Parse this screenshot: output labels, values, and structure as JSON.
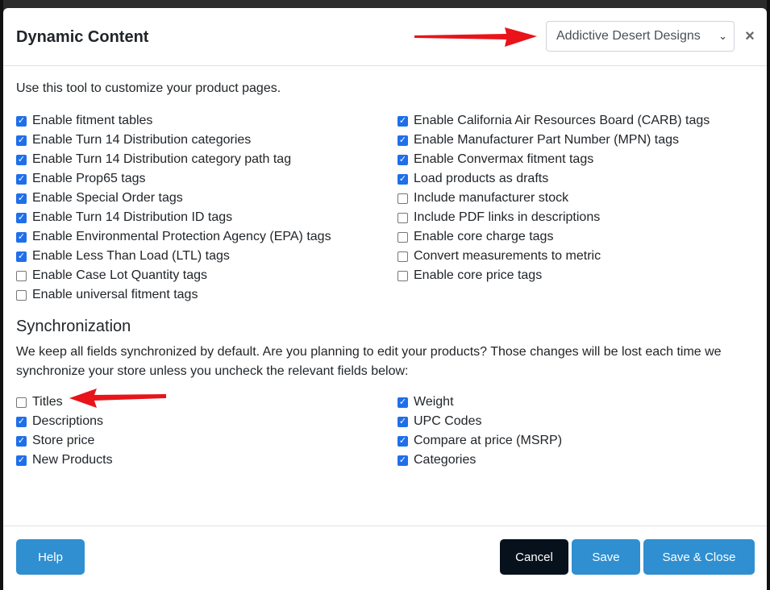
{
  "modal": {
    "title": "Dynamic Content",
    "vendor_select": {
      "value": "Addictive Desert Designs"
    },
    "close_label": "×"
  },
  "body": {
    "intro": "Use this tool to customize your product pages.",
    "options_left": [
      {
        "label": "Enable fitment tables",
        "checked": true
      },
      {
        "label": "Enable Turn 14 Distribution categories",
        "checked": true
      },
      {
        "label": "Enable Turn 14 Distribution category path tag",
        "checked": true
      },
      {
        "label": "Enable Prop65 tags",
        "checked": true
      },
      {
        "label": "Enable Special Order tags",
        "checked": true
      },
      {
        "label": "Enable Turn 14 Distribution ID tags",
        "checked": true
      },
      {
        "label": "Enable Environmental Protection Agency (EPA) tags",
        "checked": true
      },
      {
        "label": "Enable Less Than Load (LTL) tags",
        "checked": true
      },
      {
        "label": "Enable Case Lot Quantity tags",
        "checked": false
      },
      {
        "label": "Enable universal fitment tags",
        "checked": false
      }
    ],
    "options_right": [
      {
        "label": "Enable California Air Resources Board (CARB) tags",
        "checked": true
      },
      {
        "label": "Enable Manufacturer Part Number (MPN) tags",
        "checked": true
      },
      {
        "label": "Enable Convermax fitment tags",
        "checked": true
      },
      {
        "label": "Load products as drafts",
        "checked": true
      },
      {
        "label": "Include manufacturer stock",
        "checked": false
      },
      {
        "label": "Include PDF links in descriptions",
        "checked": false
      },
      {
        "label": "Enable core charge tags",
        "checked": false
      },
      {
        "label": "Convert measurements to metric",
        "checked": false
      },
      {
        "label": "Enable core price tags",
        "checked": false
      }
    ],
    "sync": {
      "title": "Synchronization",
      "description": "We keep all fields synchronized by default. Are you planning to edit your products? Those changes will be lost each time we synchronize your store unless you uncheck the relevant fields below:",
      "fields_left": [
        {
          "label": "Titles",
          "checked": false
        },
        {
          "label": "Descriptions",
          "checked": true
        },
        {
          "label": "Store price",
          "checked": true
        },
        {
          "label": "New Products",
          "checked": true
        }
      ],
      "fields_right": [
        {
          "label": "Weight",
          "checked": true
        },
        {
          "label": "UPC Codes",
          "checked": true
        },
        {
          "label": "Compare at price (MSRP)",
          "checked": true
        },
        {
          "label": "Categories",
          "checked": true
        }
      ]
    }
  },
  "footer": {
    "help_label": "Help",
    "cancel_label": "Cancel",
    "save_label": "Save",
    "save_close_label": "Save & Close"
  },
  "colors": {
    "accent_blue": "#2f8fd0",
    "checkbox_blue": "#1f6feb",
    "cancel_dark": "#06111c",
    "annotation_red": "#e8141a"
  },
  "icons": {
    "checked": "checkmark-icon",
    "close": "close-icon",
    "dropdown": "chevron-down-icon"
  }
}
